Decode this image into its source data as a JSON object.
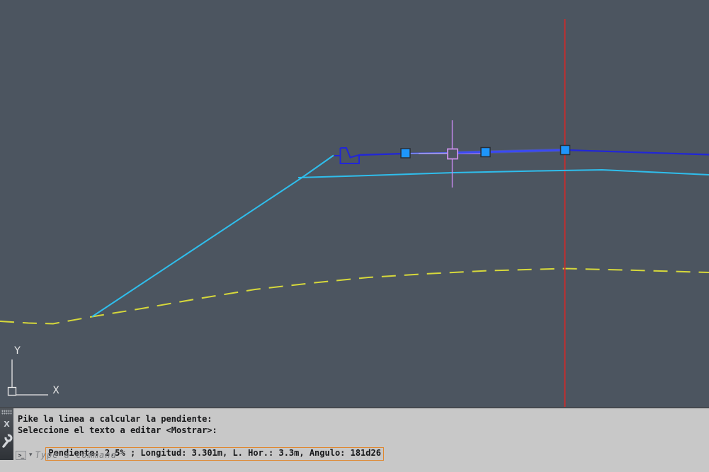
{
  "viewport": {
    "background_color": "#4C5560",
    "ucs_icon": {
      "x_label": "X",
      "y_label": "Y"
    },
    "colors": {
      "terrain_dashed_yellow": "#D6D83B",
      "slope_cyan": "#2FBEEC",
      "design_polyline_blue": "#2126D8",
      "selection_highlight_blue": "#3A49F5",
      "station_marker_red": "#C92C2C",
      "crosshair_lavender": "#BE86E4",
      "grip_fill_blue": "#1E96FB"
    },
    "selection": {
      "grip_count": 3,
      "hover_grip_visible": true
    }
  },
  "command_panel": {
    "history_lines": [
      "Pike la linea a calcular la pendiente:",
      "Seleccione el texto a editar <Mostrar>:",
      "Pendiente: 2.5% ; Longitud: 3.301m, L. Hor.: 3.3m, Angulo: 181d26"
    ],
    "highlighted_line_index": 2,
    "highlight_border_color": "#E0862C",
    "prompt": {
      "placeholder": "Type a command",
      "icon_glyph": ">_",
      "caret_glyph": "▾"
    },
    "close_button_glyph": "X"
  }
}
